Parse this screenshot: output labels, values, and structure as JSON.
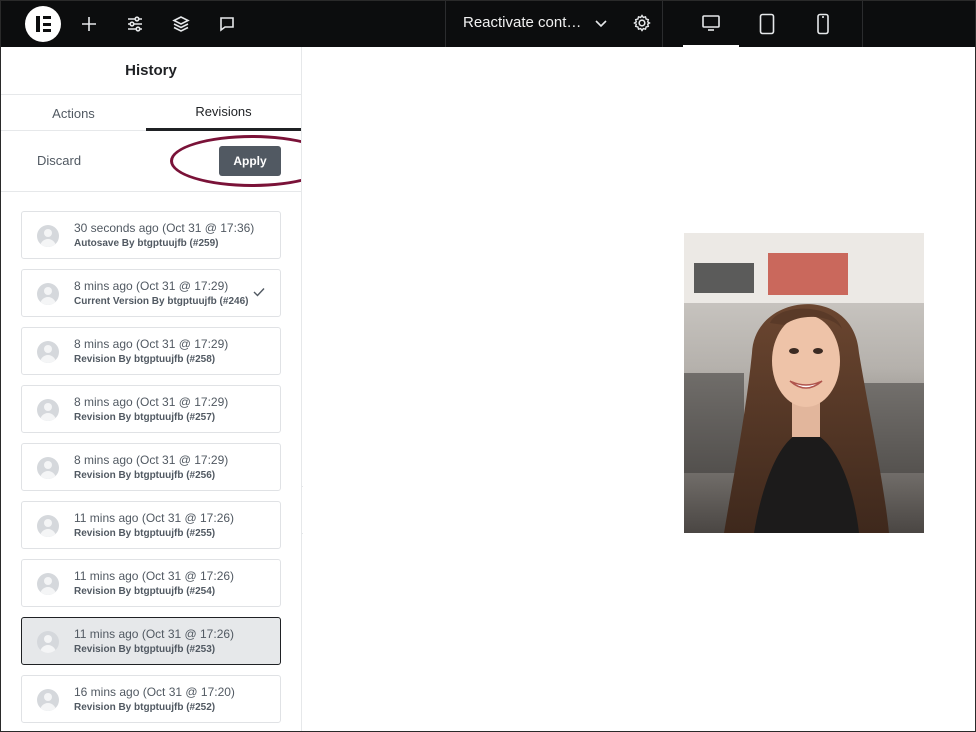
{
  "topbar": {
    "logo_icon": "elementor-logo-icon",
    "add_icon": "plus-icon",
    "settings_icon": "sliders-icon",
    "structure_icon": "layers-icon",
    "comments_icon": "chat-bubble-icon",
    "document_title": "Reactivate contai...",
    "document_dropdown_icon": "chevron-down-icon",
    "page_settings_icon": "gear-icon",
    "devices": [
      {
        "name": "desktop",
        "icon": "desktop-icon",
        "active": true
      },
      {
        "name": "tablet",
        "icon": "tablet-icon",
        "active": false
      },
      {
        "name": "mobile",
        "icon": "mobile-icon",
        "active": false
      }
    ]
  },
  "panel": {
    "title": "History",
    "tabs": [
      {
        "label": "Actions",
        "active": false
      },
      {
        "label": "Revisions",
        "active": true
      }
    ],
    "discard_label": "Discard",
    "apply_label": "Apply",
    "highlight_color": "#7a1238",
    "revisions": [
      {
        "time": "30 seconds ago (Oct 31 @ 17:36)",
        "meta": "Autosave By btgptuujfb (#259)",
        "current": false,
        "selected": false
      },
      {
        "time": "8 mins ago (Oct 31 @ 17:29)",
        "meta": "Current Version By btgptuujfb (#246)",
        "current": true,
        "selected": false
      },
      {
        "time": "8 mins ago (Oct 31 @ 17:29)",
        "meta": "Revision By btgptuujfb (#258)",
        "current": false,
        "selected": false
      },
      {
        "time": "8 mins ago (Oct 31 @ 17:29)",
        "meta": "Revision By btgptuujfb (#257)",
        "current": false,
        "selected": false
      },
      {
        "time": "8 mins ago (Oct 31 @ 17:29)",
        "meta": "Revision By btgptuujfb (#256)",
        "current": false,
        "selected": false
      },
      {
        "time": "11 mins ago (Oct 31 @ 17:26)",
        "meta": "Revision By btgptuujfb (#255)",
        "current": false,
        "selected": false
      },
      {
        "time": "11 mins ago (Oct 31 @ 17:26)",
        "meta": "Revision By btgptuujfb (#254)",
        "current": false,
        "selected": false
      },
      {
        "time": "11 mins ago (Oct 31 @ 17:26)",
        "meta": "Revision By btgptuujfb (#253)",
        "current": false,
        "selected": true
      },
      {
        "time": "16 mins ago (Oct 31 @ 17:20)",
        "meta": "Revision By btgptuujfb (#252)",
        "current": false,
        "selected": false
      }
    ],
    "collapse_icon": "chevron-left-icon"
  },
  "canvas": {
    "image_icon": "portrait-photo"
  }
}
